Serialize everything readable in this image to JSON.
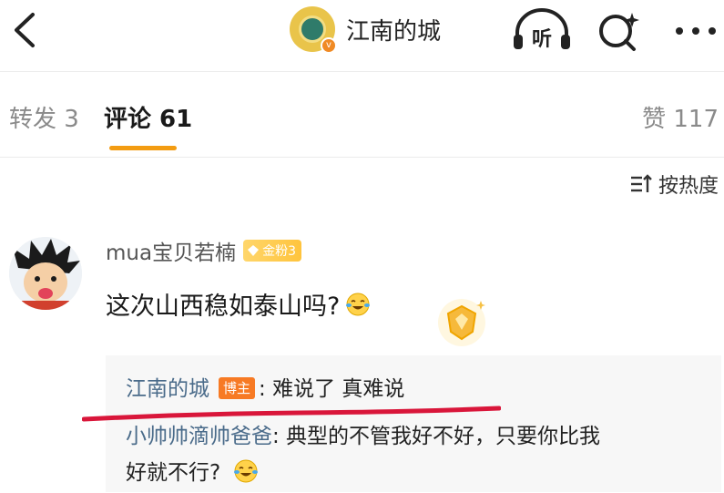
{
  "header": {
    "profile_name": "江南的城",
    "verify_badge": "v",
    "listen_label": "听"
  },
  "tabs": {
    "repost": "转发 3",
    "comment": "评论 61",
    "like": "赞 117"
  },
  "sort": {
    "label": "按热度"
  },
  "comment": {
    "author": "mua宝贝若楠",
    "fan_badge": "金粉3",
    "text": "这次山西稳如泰山吗?",
    "replies": [
      {
        "name": "江南的城",
        "tag": "博主",
        "text": ": 难说了 真难说"
      },
      {
        "name": "小帅帅滴帅爸爸",
        "text": ": 典型的不管我好不好，只要你比我",
        "continuation": "好就不行?"
      }
    ]
  },
  "colors": {
    "accent": "#f39c12",
    "reply_name": "#4a6b8a",
    "blogger_tag": "#f77a24",
    "annotation_line": "#d9163a"
  }
}
